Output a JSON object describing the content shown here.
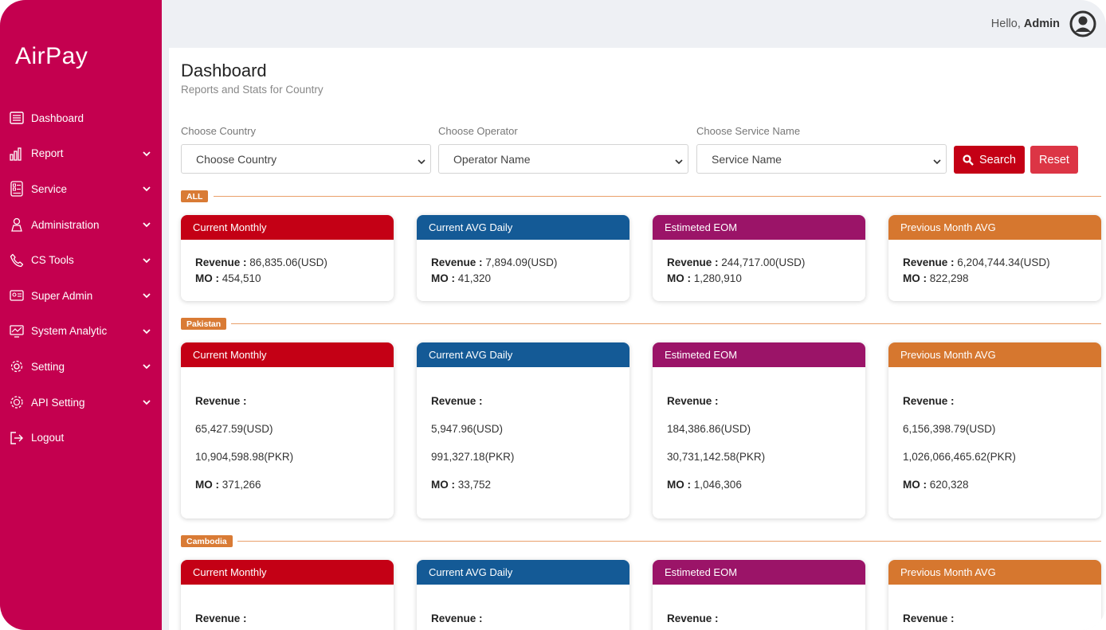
{
  "brand": {
    "name": "AirPay"
  },
  "colors": {
    "sidebar": "#c4004f",
    "accent_red": "#c40015",
    "accent_blue": "#145a96",
    "accent_purple": "#9b1468",
    "accent_orange": "#d6772f",
    "section_tag": "#d97b35"
  },
  "sidebar": {
    "items": [
      {
        "label": "Dashboard",
        "icon": "dashboard-icon",
        "expandable": false
      },
      {
        "label": "Report",
        "icon": "bar-chart-icon",
        "expandable": true
      },
      {
        "label": "Service",
        "icon": "service-list-icon",
        "expandable": true
      },
      {
        "label": "Administration",
        "icon": "person-icon",
        "expandable": true
      },
      {
        "label": "CS Tools",
        "icon": "phone-icon",
        "expandable": true
      },
      {
        "label": "Super Admin",
        "icon": "id-card-icon",
        "expandable": true
      },
      {
        "label": "System Analytic",
        "icon": "monitor-chart-icon",
        "expandable": true
      },
      {
        "label": "Setting",
        "icon": "gear-icon",
        "expandable": true
      },
      {
        "label": "API Setting",
        "icon": "api-gear-icon",
        "expandable": true
      },
      {
        "label": "Logout",
        "icon": "logout-icon",
        "expandable": false
      }
    ]
  },
  "header": {
    "greeting": "Hello,",
    "user": "Admin",
    "avatar_icon": "user-circle-icon"
  },
  "page": {
    "title": "Dashboard",
    "subtitle": "Reports and Stats for Country"
  },
  "filters": {
    "country": {
      "label": "Choose Country",
      "value": "Choose Country"
    },
    "operator": {
      "label": "Choose Operator",
      "value": "Operator Name"
    },
    "service": {
      "label": "Choose Service Name",
      "value": "Service Name"
    },
    "search_label": "Search",
    "reset_label": "Reset"
  },
  "labels": {
    "revenue": "Revenue :",
    "mo": "MO :"
  },
  "card_titles": [
    "Current Monthly",
    "Current AVG Daily",
    "Estimeted EOM",
    "Previous Month AVG"
  ],
  "sections": {
    "all": {
      "tag": "ALL",
      "cards": [
        {
          "revenue": "86,835.06(USD)",
          "mo": "454,510"
        },
        {
          "revenue": "7,894.09(USD)",
          "mo": "41,320"
        },
        {
          "revenue": "244,717.00(USD)",
          "mo": "1,280,910"
        },
        {
          "revenue": "6,204,744.34(USD)",
          "mo": "822,298"
        }
      ]
    },
    "pakistan": {
      "tag": "Pakistan",
      "cards": [
        {
          "usd": "65,427.59(USD)",
          "local": "10,904,598.98(PKR)",
          "mo": "371,266"
        },
        {
          "usd": "5,947.96(USD)",
          "local": "991,327.18(PKR)",
          "mo": "33,752"
        },
        {
          "usd": "184,386.86(USD)",
          "local": "30,731,142.58(PKR)",
          "mo": "1,046,306"
        },
        {
          "usd": "6,156,398.79(USD)",
          "local": "1,026,066,465.62(PKR)",
          "mo": "620,328"
        }
      ]
    },
    "cambodia": {
      "tag": "Cambodia"
    }
  }
}
